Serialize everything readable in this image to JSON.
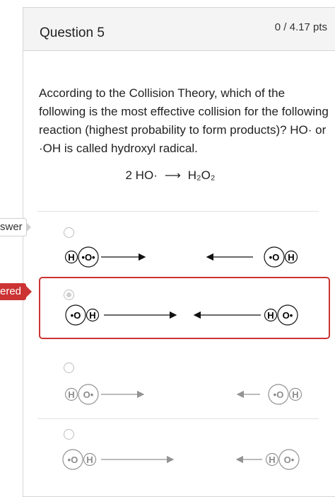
{
  "side_tabs": {
    "answer": "swer",
    "answered": "ered"
  },
  "question": {
    "title": "Question 5",
    "points": "0 / 4.17 pts",
    "prompt": "According to the Collision Theory, which of the following is the most effective collision for the following reaction (highest probability to form products)? HO· or ·OH is called hydroxyl radical.",
    "equation": {
      "left": "2 HO·",
      "arrow": "⟶",
      "right": "H₂O₂"
    }
  },
  "options": [
    {
      "left": [
        "H",
        "•O•"
      ],
      "right": [
        "•O",
        "H"
      ],
      "selected": false
    },
    {
      "left": [
        "•O",
        "H"
      ],
      "right": [
        "H",
        "O•"
      ],
      "selected": true
    },
    {
      "left": [
        "H",
        "O•"
      ],
      "right": [
        "•O",
        "H"
      ],
      "selected": false
    },
    {
      "left": [
        "•O",
        "H"
      ],
      "right": [
        "H",
        "O•"
      ],
      "selected": false
    }
  ],
  "colors": {
    "selected_border": "#cc3333",
    "answered_tab": "#cc3333"
  }
}
